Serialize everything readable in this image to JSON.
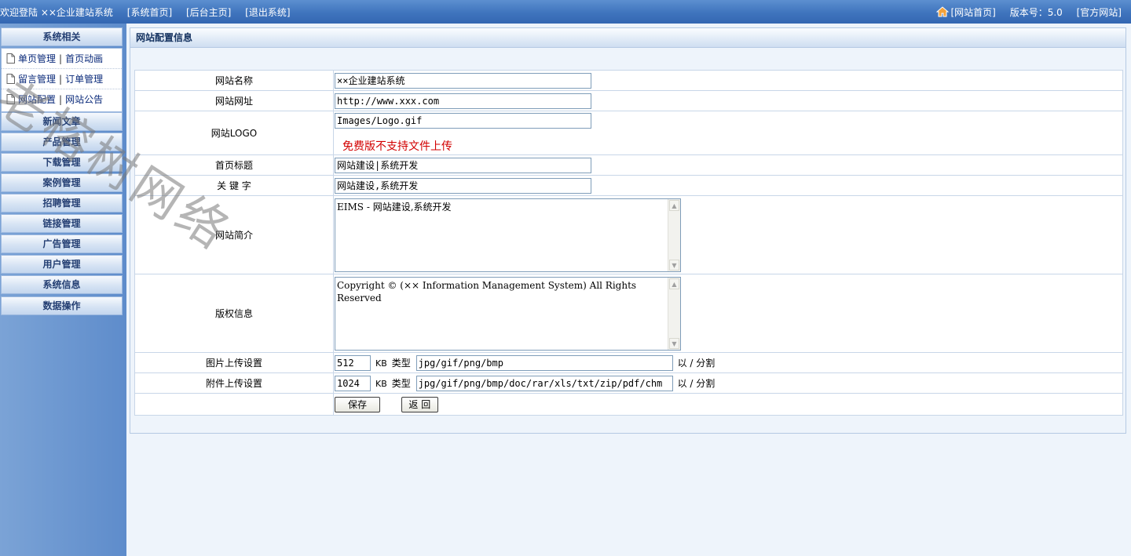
{
  "topbar": {
    "welcome": "欢迎登陆 ××企业建站系统",
    "links": [
      "[系统首页]",
      "[后台主页]",
      "[退出系统]"
    ],
    "site_home": "[网站首页]",
    "version": "版本号：5.0",
    "official": "[官方网站]"
  },
  "sidebar": {
    "top_head": "系统相关",
    "sub_rows": [
      [
        "单页管理",
        "首页动画"
      ],
      [
        "留言管理",
        "订单管理"
      ],
      [
        "网站配置",
        "网站公告"
      ]
    ],
    "sections": [
      "新闻文章",
      "产品管理",
      "下载管理",
      "案例管理",
      "招聘管理",
      "链接管理",
      "广告管理",
      "用户管理",
      "系统信息",
      "数据操作"
    ]
  },
  "main": {
    "title": "网站配置信息",
    "labels": {
      "site_name": "网站名称",
      "site_url": "网站网址",
      "site_logo": "网站LOGO",
      "home_title": "首页标题",
      "keywords": "关 键 字",
      "intro": "网站简介",
      "copyright": "版权信息",
      "image_upload": "图片上传设置",
      "attach_upload": "附件上传设置"
    },
    "values": {
      "site_name": "××企业建站系统",
      "site_url": "http://www.xxx.com",
      "site_logo": "Images/Logo.gif",
      "home_title": "网站建设|系统开发",
      "keywords": "网站建设,系统开发",
      "intro": "EIMS - 网站建设,系统开发",
      "copyright": "Copyright © (×× Information Management System) All Rights Reserved",
      "image_size": "512",
      "image_types": "jpg/gif/png/bmp",
      "attach_size": "1024",
      "attach_types": "jpg/gif/png/bmp/doc/rar/xls/txt/zip/pdf/chm"
    },
    "no_upload": "免费版不支持文件上传",
    "unit_kb": "KB",
    "type_label": "类型",
    "separator_note": "以 / 分割",
    "save_label": "保存",
    "back_label": "返 回"
  },
  "watermark": "老榕树网络",
  "colors": {
    "topbar": "#3f74bd",
    "sidebar": "#6a96cf",
    "error_text": "#d20000"
  }
}
